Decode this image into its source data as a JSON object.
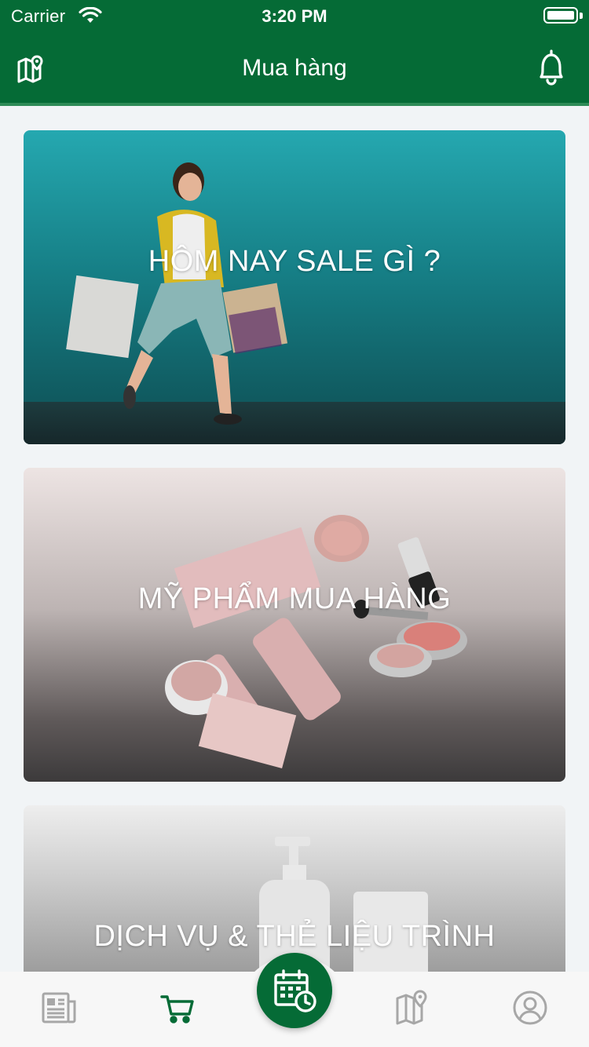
{
  "status_bar": {
    "carrier": "Carrier",
    "time": "3:20 PM"
  },
  "header": {
    "title": "Mua hàng",
    "left_icon": "map-pin-icon",
    "right_icon": "bell-icon"
  },
  "cards": [
    {
      "label": "HÔM NAY SALE GÌ ?"
    },
    {
      "label": "MỸ PHẨM MUA HÀNG"
    },
    {
      "label": "DỊCH VỤ & THẺ LIỆU TRÌNH"
    }
  ],
  "tabbar": {
    "items": [
      {
        "icon": "newspaper-icon",
        "active": false
      },
      {
        "icon": "cart-icon",
        "active": true
      },
      {
        "icon": "calendar-clock-icon",
        "active": false
      },
      {
        "icon": "map-pin-icon",
        "active": false
      },
      {
        "icon": "user-icon",
        "active": false
      }
    ]
  },
  "colors": {
    "primary": "#056b36",
    "active_tab": "#056b36",
    "inactive_tab": "#a7a7a7",
    "background": "#f1f4f6"
  }
}
